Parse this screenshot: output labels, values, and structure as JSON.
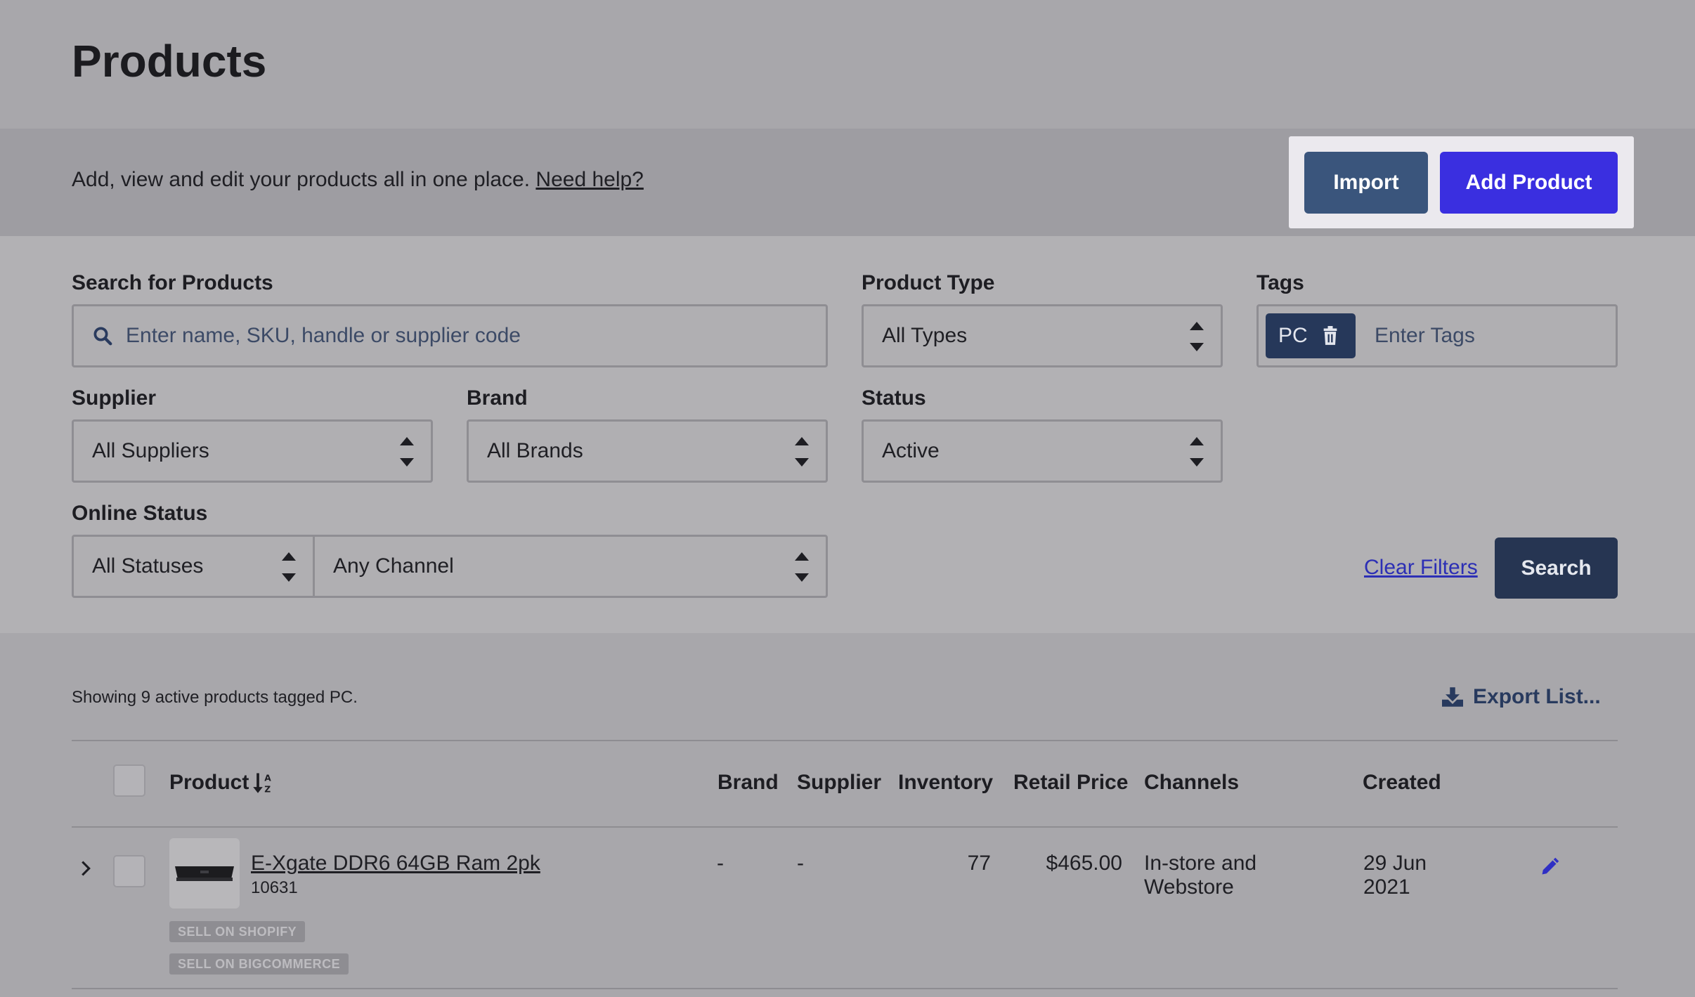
{
  "page": {
    "title": "Products"
  },
  "subbar": {
    "description": "Add, view and edit your products all in one place.",
    "help_link": "Need help?",
    "import_label": "Import",
    "add_label": "Add Product"
  },
  "filters": {
    "search_label": "Search for Products",
    "search_placeholder": "Enter name, SKU, handle or supplier code",
    "product_type_label": "Product Type",
    "product_type_value": "All Types",
    "tags_label": "Tags",
    "tag_chip": "PC",
    "tags_placeholder": "Enter Tags",
    "supplier_label": "Supplier",
    "supplier_value": "All Suppliers",
    "brand_label": "Brand",
    "brand_value": "All Brands",
    "status_label": "Status",
    "status_value": "Active",
    "online_status_label": "Online Status",
    "online_status_value": "All Statuses",
    "channel_value": "Any Channel",
    "clear_label": "Clear Filters",
    "search_button": "Search"
  },
  "results": {
    "count_text": "Showing 9 active products tagged PC.",
    "export_label": "Export List...",
    "columns": {
      "product": "Product",
      "brand": "Brand",
      "supplier": "Supplier",
      "inventory": "Inventory",
      "retail_price": "Retail Price",
      "channels": "Channels",
      "created": "Created"
    },
    "rows": [
      {
        "name": "E-Xgate DDR6 64GB Ram 2pk",
        "sku": "10631",
        "brand": "-",
        "supplier": "-",
        "inventory": "77",
        "retail_price": "$465.00",
        "channels_line1": "In-store and",
        "channels_line2": "Webstore",
        "created_line1": "29 Jun",
        "created_line2": "2021",
        "badges": [
          "SELL ON SHOPIFY",
          "SELL ON BIGCOMMERCE"
        ]
      }
    ]
  },
  "colors": {
    "accent": "#3a2fe0",
    "import": "#3a557c",
    "search": "#263552",
    "link": "#2c2fb5"
  },
  "icons": [
    "search-icon",
    "trash-icon",
    "chevron-updown-icon",
    "download-icon",
    "sort-az-icon",
    "chevron-right-icon",
    "pencil-icon"
  ]
}
